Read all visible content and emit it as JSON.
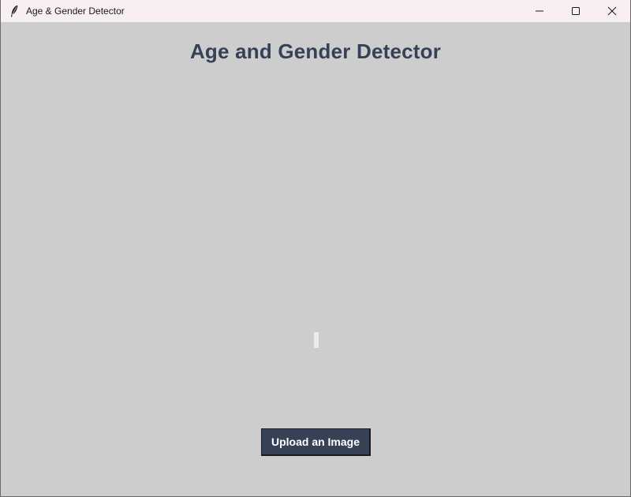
{
  "window": {
    "title": "Age & Gender Detector",
    "icon": "feather-icon",
    "controls": {
      "minimize_icon": "minimize-icon",
      "maximize_icon": "maximize-icon",
      "close_icon": "close-icon"
    }
  },
  "main": {
    "heading": "Age and Gender Detector",
    "result_text": "",
    "upload_button_label": "Upload an Image"
  },
  "colors": {
    "background": "#cdcdcd",
    "titlebar": "#f8eff3",
    "heading": "#364156",
    "button_bg": "#364156",
    "button_text": "#ffffff"
  }
}
